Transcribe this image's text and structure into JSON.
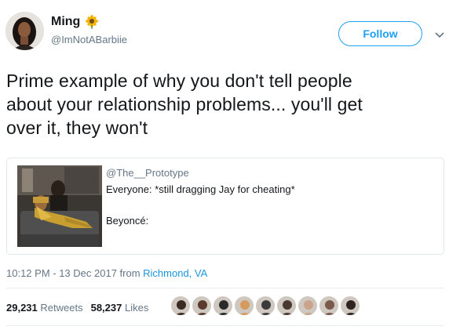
{
  "author": {
    "display_name": "Ming",
    "handle": "@ImNotABarbiie",
    "name_emoji": "sunflower-emoji"
  },
  "follow_button": {
    "label": "Follow"
  },
  "tweet": {
    "line1": "Prime example of why you don't tell people",
    "line2": "about your relationship problems... you'll get",
    "line3": "over it, they won't"
  },
  "quoted": {
    "handle": "@The__Prototype",
    "line1": "Everyone: *still dragging Jay for cheating*",
    "line2": "Beyoncé:"
  },
  "meta": {
    "timestamp": "10:12 PM - 13 Dec 2017 from ",
    "location": "Richmond, VA"
  },
  "stats": {
    "retweets_count": "29,231",
    "retweets_label": "Retweets",
    "likes_count": "58,237",
    "likes_label": "Likes"
  },
  "likers": {
    "colors": [
      "#3a2a24",
      "#5a3b2e",
      "#2a2a2a",
      "#d69a5e",
      "#3b3b3b",
      "#4a3a33",
      "#c9a38a",
      "#7a5a4a",
      "#2f2320"
    ]
  },
  "colors": {
    "accent": "#1da1f2",
    "link": "#1b95e0",
    "secondary_text": "#657786"
  }
}
